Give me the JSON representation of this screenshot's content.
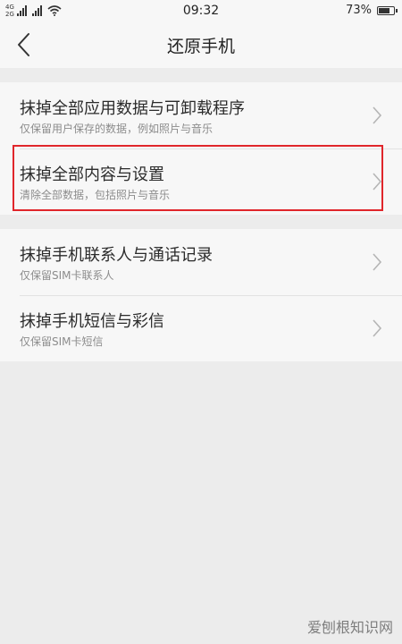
{
  "status_bar": {
    "network_1": "4G",
    "network_2": "2G",
    "time": "09:32",
    "battery_percent": "73%",
    "battery_level": 0.73,
    "icons": [
      "signal-icon",
      "signal-icon",
      "wifi-icon",
      "battery-icon"
    ]
  },
  "nav": {
    "title": "还原手机",
    "back_icon": "chevron-left-icon"
  },
  "groups": [
    {
      "items": [
        {
          "title": "抹掉全部应用数据与可卸载程序",
          "subtitle": "仅保留用户保存的数据，例如照片与音乐"
        },
        {
          "title": "抹掉全部内容与设置",
          "subtitle": "清除全部数据，包括照片与音乐",
          "highlighted": true
        }
      ]
    },
    {
      "items": [
        {
          "title": "抹掉手机联系人与通话记录",
          "subtitle": "仅保留SIM卡联系人"
        },
        {
          "title": "抹掉手机短信与彩信",
          "subtitle": "仅保留SIM卡短信"
        }
      ]
    }
  ],
  "highlight_color": "#e0262b",
  "watermark": "爱刨根知识网"
}
